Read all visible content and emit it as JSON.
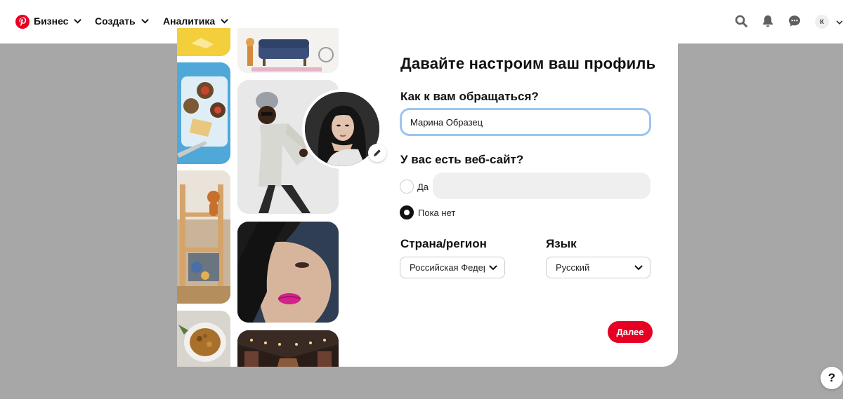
{
  "header": {
    "logo_icon": "pinterest-logo",
    "nav": [
      {
        "label": "Бизнес"
      },
      {
        "label": "Создать"
      },
      {
        "label": "Аналитика"
      }
    ],
    "icons": [
      "search-icon",
      "notifications-bell-icon",
      "messages-icon"
    ],
    "avatar_initial": "К",
    "brand_color": "#e60023"
  },
  "modal": {
    "title": "Давайте настроим ваш профиль",
    "name_label": "Как к вам обращаться?",
    "name_value": "Марина Образец",
    "website_label": "У вас есть веб-сайт?",
    "website_options": [
      {
        "label": "Да",
        "selected": false
      },
      {
        "label": "Пока нет",
        "selected": true
      }
    ],
    "website_value": "",
    "country_label": "Страна/регион",
    "country_value": "Российская Федерация",
    "language_label": "Язык",
    "language_value": "Русский",
    "next_button": "Далее"
  },
  "help_button": "?"
}
